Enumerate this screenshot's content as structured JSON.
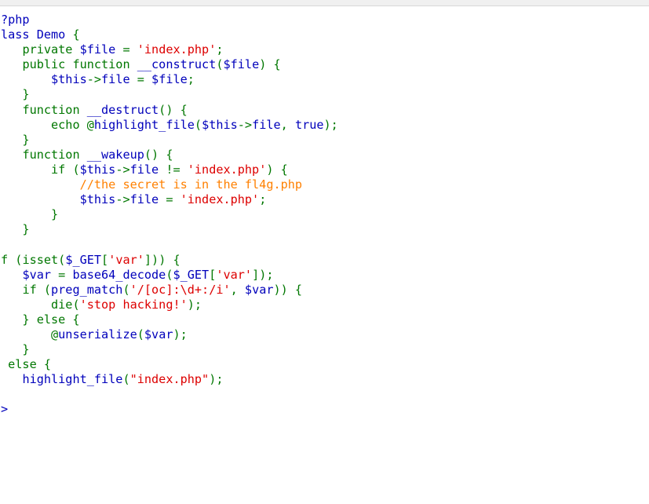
{
  "code": {
    "lines": [
      [
        {
          "t": "?php",
          "c": "b"
        }
      ],
      [
        {
          "t": "lass Demo ",
          "c": "b"
        },
        {
          "t": "{",
          "c": "g"
        }
      ],
      [
        {
          "t": "   ",
          "c": "g"
        },
        {
          "t": "private ",
          "c": "g"
        },
        {
          "t": "$file ",
          "c": "b"
        },
        {
          "t": "= ",
          "c": "g"
        },
        {
          "t": "'index.php'",
          "c": "s"
        },
        {
          "t": ";",
          "c": "g"
        }
      ],
      [
        {
          "t": "   ",
          "c": "g"
        },
        {
          "t": "public function ",
          "c": "g"
        },
        {
          "t": "__construct",
          "c": "b"
        },
        {
          "t": "(",
          "c": "g"
        },
        {
          "t": "$file",
          "c": "b"
        },
        {
          "t": ") {",
          "c": "g"
        }
      ],
      [
        {
          "t": "       ",
          "c": "g"
        },
        {
          "t": "$this",
          "c": "b"
        },
        {
          "t": "->",
          "c": "g"
        },
        {
          "t": "file ",
          "c": "b"
        },
        {
          "t": "= ",
          "c": "g"
        },
        {
          "t": "$file",
          "c": "b"
        },
        {
          "t": ";",
          "c": "g"
        }
      ],
      [
        {
          "t": "   }",
          "c": "g"
        }
      ],
      [
        {
          "t": "   ",
          "c": "g"
        },
        {
          "t": "function ",
          "c": "g"
        },
        {
          "t": "__destruct",
          "c": "b"
        },
        {
          "t": "() {",
          "c": "g"
        }
      ],
      [
        {
          "t": "       ",
          "c": "g"
        },
        {
          "t": "echo @",
          "c": "g"
        },
        {
          "t": "highlight_file",
          "c": "b"
        },
        {
          "t": "(",
          "c": "g"
        },
        {
          "t": "$this",
          "c": "b"
        },
        {
          "t": "->",
          "c": "g"
        },
        {
          "t": "file",
          "c": "b"
        },
        {
          "t": ", ",
          "c": "g"
        },
        {
          "t": "true",
          "c": "b"
        },
        {
          "t": ");",
          "c": "g"
        }
      ],
      [
        {
          "t": "   }",
          "c": "g"
        }
      ],
      [
        {
          "t": "   ",
          "c": "g"
        },
        {
          "t": "function ",
          "c": "g"
        },
        {
          "t": "__wakeup",
          "c": "b"
        },
        {
          "t": "() {",
          "c": "g"
        }
      ],
      [
        {
          "t": "       ",
          "c": "g"
        },
        {
          "t": "if (",
          "c": "g"
        },
        {
          "t": "$this",
          "c": "b"
        },
        {
          "t": "->",
          "c": "g"
        },
        {
          "t": "file ",
          "c": "b"
        },
        {
          "t": "!= ",
          "c": "g"
        },
        {
          "t": "'index.php'",
          "c": "s"
        },
        {
          "t": ") {",
          "c": "g"
        }
      ],
      [
        {
          "t": "           ",
          "c": "g"
        },
        {
          "t": "//the secret is in the fl4g.php",
          "c": "c"
        }
      ],
      [
        {
          "t": "           ",
          "c": "g"
        },
        {
          "t": "$this",
          "c": "b"
        },
        {
          "t": "->",
          "c": "g"
        },
        {
          "t": "file ",
          "c": "b"
        },
        {
          "t": "= ",
          "c": "g"
        },
        {
          "t": "'index.php'",
          "c": "s"
        },
        {
          "t": ";",
          "c": "g"
        }
      ],
      [
        {
          "t": "       }",
          "c": "g"
        }
      ],
      [
        {
          "t": "   }",
          "c": "g"
        }
      ],
      [
        {
          "t": "",
          "c": "g"
        }
      ],
      [
        {
          "t": "f (",
          "c": "g"
        },
        {
          "t": "isset",
          "c": "g"
        },
        {
          "t": "(",
          "c": "g"
        },
        {
          "t": "$_GET",
          "c": "b"
        },
        {
          "t": "[",
          "c": "g"
        },
        {
          "t": "'var'",
          "c": "s"
        },
        {
          "t": "])) {",
          "c": "g"
        }
      ],
      [
        {
          "t": "   ",
          "c": "g"
        },
        {
          "t": "$var ",
          "c": "b"
        },
        {
          "t": "= ",
          "c": "g"
        },
        {
          "t": "base64_decode",
          "c": "b"
        },
        {
          "t": "(",
          "c": "g"
        },
        {
          "t": "$_GET",
          "c": "b"
        },
        {
          "t": "[",
          "c": "g"
        },
        {
          "t": "'var'",
          "c": "s"
        },
        {
          "t": "]);",
          "c": "g"
        }
      ],
      [
        {
          "t": "   ",
          "c": "g"
        },
        {
          "t": "if (",
          "c": "g"
        },
        {
          "t": "preg_match",
          "c": "b"
        },
        {
          "t": "(",
          "c": "g"
        },
        {
          "t": "'/[oc]:\\d+:/i'",
          "c": "s"
        },
        {
          "t": ", ",
          "c": "g"
        },
        {
          "t": "$var",
          "c": "b"
        },
        {
          "t": ")) {",
          "c": "g"
        }
      ],
      [
        {
          "t": "       ",
          "c": "g"
        },
        {
          "t": "die(",
          "c": "g"
        },
        {
          "t": "'stop hacking!'",
          "c": "s"
        },
        {
          "t": ");",
          "c": "g"
        }
      ],
      [
        {
          "t": "   } else {",
          "c": "g"
        }
      ],
      [
        {
          "t": "       @",
          "c": "g"
        },
        {
          "t": "unserialize",
          "c": "b"
        },
        {
          "t": "(",
          "c": "g"
        },
        {
          "t": "$var",
          "c": "b"
        },
        {
          "t": ");",
          "c": "g"
        }
      ],
      [
        {
          "t": "   }",
          "c": "g"
        }
      ],
      [
        {
          "t": " else {",
          "c": "g"
        }
      ],
      [
        {
          "t": "   ",
          "c": "g"
        },
        {
          "t": "highlight_file",
          "c": "b"
        },
        {
          "t": "(",
          "c": "g"
        },
        {
          "t": "\"index.php\"",
          "c": "s"
        },
        {
          "t": ");",
          "c": "g"
        }
      ],
      [
        {
          "t": "",
          "c": "g"
        }
      ],
      [
        {
          "t": ">",
          "c": "b"
        }
      ]
    ]
  }
}
